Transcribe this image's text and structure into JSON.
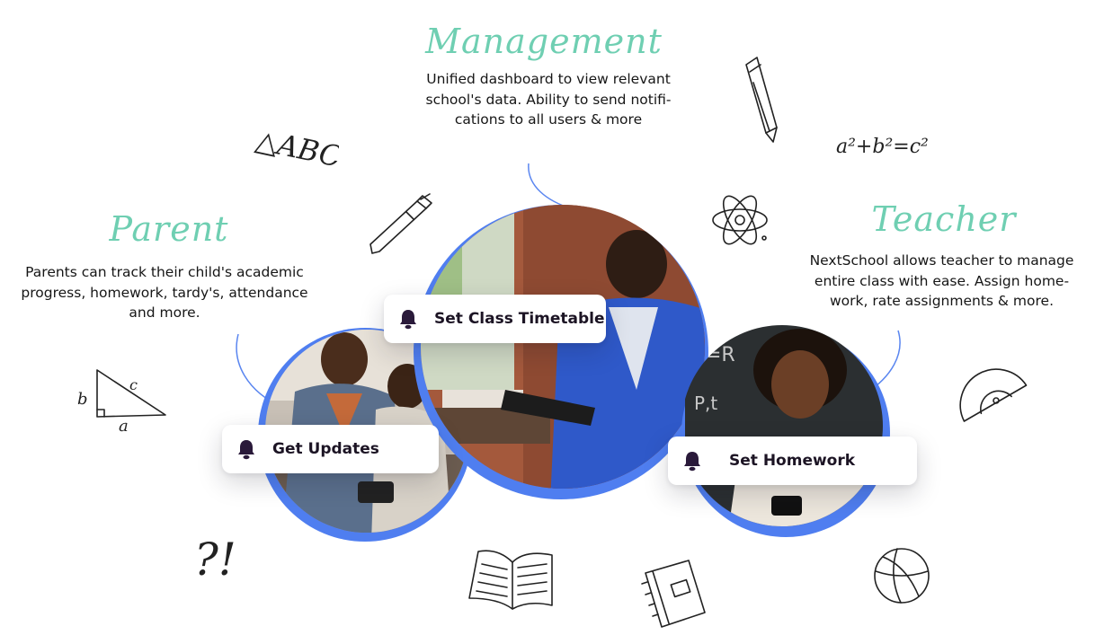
{
  "sections": {
    "management": {
      "title": "Management",
      "lines": [
        "Unified dashboard to view relevant",
        "school's data. Ability to send notifi-",
        "cations to all users & more"
      ]
    },
    "parent": {
      "title": "Parent",
      "lines": [
        "Parents can track their child's academic",
        "progress, homework, tardy's, attendance",
        "and more."
      ]
    },
    "teacher": {
      "title": "Teacher",
      "lines": [
        "NextSchool allows teacher to manage",
        "entire class with ease. Assign home-",
        "work, rate assignments & more."
      ]
    }
  },
  "actions": {
    "timetable": {
      "label": "Set Class Timetable",
      "icon": "bell-icon"
    },
    "updates": {
      "label": "Get Updates",
      "icon": "bell-icon"
    },
    "homework": {
      "label": "Set Homework",
      "icon": "bell-icon"
    }
  },
  "doodles": {
    "abc": "△ABC",
    "formula": "a²+b²=c²",
    "tri_b": "b",
    "tri_c": "c",
    "tri_a": "a",
    "question": "?!"
  },
  "colors": {
    "accent": "#6fcfb2",
    "ring": "#4f7ef0",
    "icon": "#2a1a3a"
  }
}
